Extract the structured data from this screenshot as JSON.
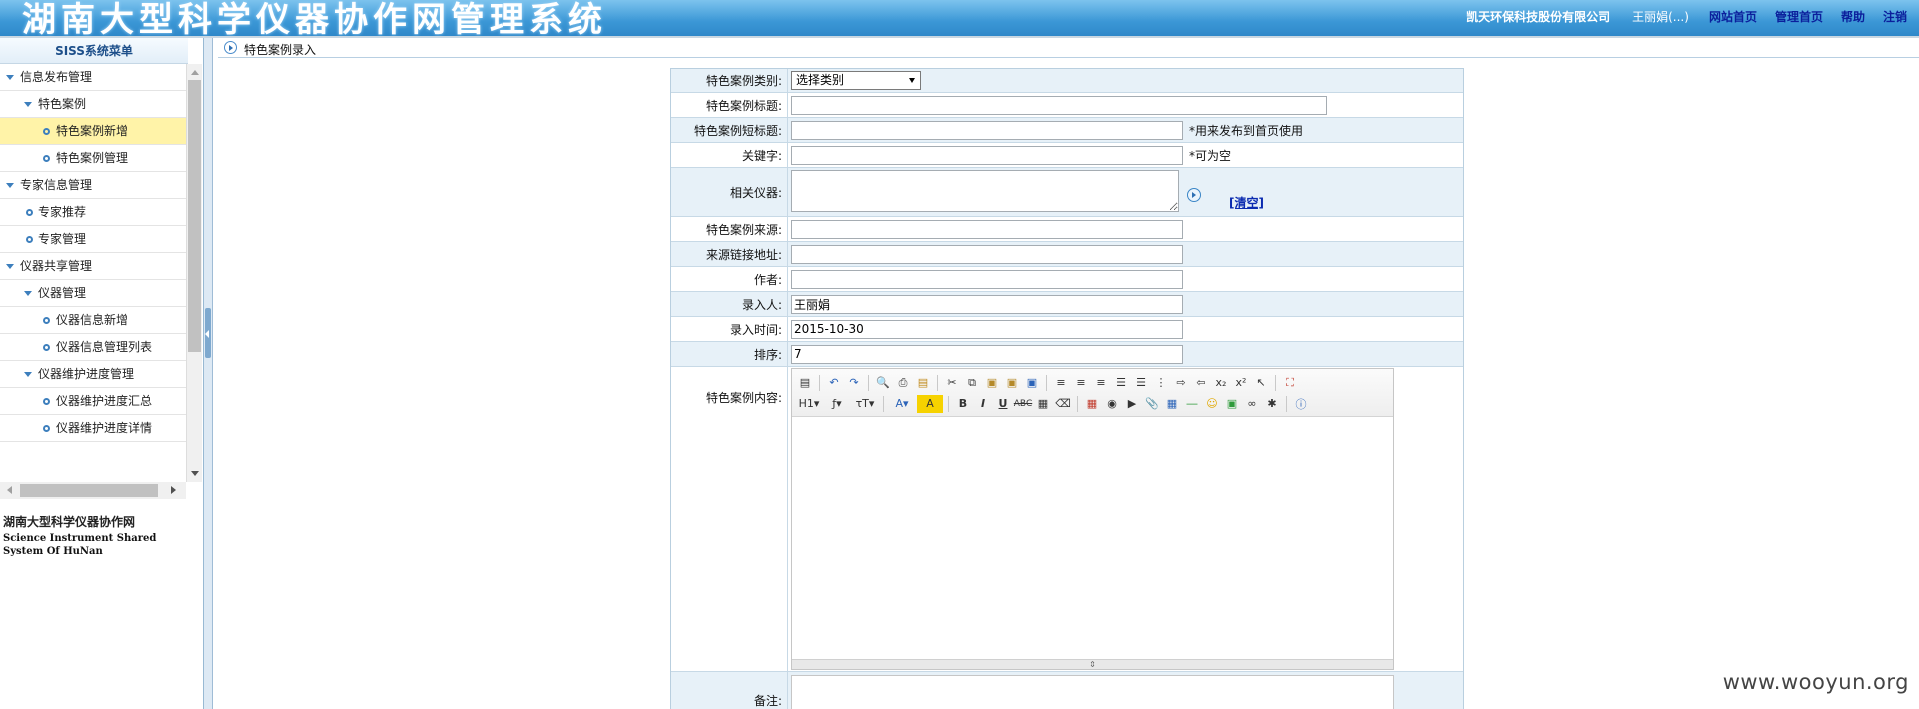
{
  "header": {
    "title": "湖南大型科学仪器协作网管理系统",
    "company": "凯天环保科技股份有限公司",
    "user": "王丽娟(...)",
    "links": [
      "网站首页",
      "管理首页",
      "帮助",
      "注销"
    ]
  },
  "sidebar": {
    "title": "SISS系统菜单",
    "items": [
      {
        "label": "信息发布管理",
        "level": 0,
        "icon": "expand-triangle"
      },
      {
        "label": "特色案例",
        "level": 1,
        "icon": "expand-triangle"
      },
      {
        "label": "特色案例新增",
        "level": 2,
        "icon": "circle-bullet",
        "selected": true
      },
      {
        "label": "特色案例管理",
        "level": 2,
        "icon": "circle-bullet"
      },
      {
        "label": "专家信息管理",
        "level": 0,
        "icon": "expand-triangle"
      },
      {
        "label": "专家推荐",
        "level": 1,
        "icon": "circle-bullet"
      },
      {
        "label": "专家管理",
        "level": 1,
        "icon": "circle-bullet"
      },
      {
        "label": "仪器共享管理",
        "level": 0,
        "icon": "expand-triangle"
      },
      {
        "label": "仪器管理",
        "level": 1,
        "icon": "expand-triangle"
      },
      {
        "label": "仪器信息新增",
        "level": 2,
        "icon": "circle-bullet"
      },
      {
        "label": "仪器信息管理列表",
        "level": 2,
        "icon": "circle-bullet"
      },
      {
        "label": "仪器维护进度管理",
        "level": 1,
        "icon": "expand-triangle"
      },
      {
        "label": "仪器维护进度汇总",
        "level": 2,
        "icon": "circle-bullet"
      },
      {
        "label": "仪器维护进度详情",
        "level": 2,
        "icon": "circle-bullet"
      }
    ],
    "brand_cn": "湖南大型科学仪器协作网",
    "brand_en": "Science Instrument Shared System Of HuNan"
  },
  "breadcrumb": {
    "text": "特色案例录入"
  },
  "form": {
    "category_label": "特色案例类别:",
    "category_value": "选择类别",
    "title_label": "特色案例标题:",
    "title_value": "",
    "short_title_label": "特色案例短标题:",
    "short_title_value": "",
    "short_title_hint": "*用来发布到首页使用",
    "keyword_label": "关键字:",
    "keyword_value": "",
    "keyword_hint": "*可为空",
    "instrument_label": "相关仪器:",
    "instrument_value": "",
    "clear_link": "[清空]",
    "source_label": "特色案例来源:",
    "source_value": "",
    "source_url_label": "来源链接地址:",
    "source_url_value": "",
    "author_label": "作者:",
    "author_value": "",
    "entry_person_label": "录入人:",
    "entry_person_value": "王丽娟",
    "entry_time_label": "录入时间:",
    "entry_time_value": "2015-10-30",
    "order_label": "排序:",
    "order_value": "7",
    "content_label": "特色案例内容:",
    "remark_label": "备注:"
  },
  "editor": {
    "toolbar_row1": [
      "source-icon",
      "undo-icon",
      "redo-icon",
      "preview-icon",
      "print-icon",
      "template-icon",
      "cut-icon",
      "copy-icon",
      "paste-icon",
      "paste-text-icon",
      "paste-word-icon",
      "align-left-icon",
      "align-center-icon",
      "align-right-icon",
      "align-justify-icon",
      "ordered-list-icon",
      "unordered-list-icon",
      "indent-icon",
      "outdent-icon",
      "subscript-icon",
      "superscript-icon",
      "select-all-icon",
      "fullscreen-icon"
    ],
    "toolbar_row2": [
      "heading-icon",
      "font-family-icon",
      "font-size-icon",
      "font-color-icon",
      "highlight-icon",
      "bold-icon",
      "italic-icon",
      "underline-icon",
      "strikethrough-icon",
      "line-height-icon",
      "clear-format-icon",
      "image-icon",
      "flash-icon",
      "media-icon",
      "attachment-icon",
      "table-icon",
      "hr-icon",
      "emoticon-icon",
      "map-icon",
      "link-icon",
      "unlink-icon",
      "help-icon"
    ]
  },
  "watermark": "www.wooyun.org"
}
